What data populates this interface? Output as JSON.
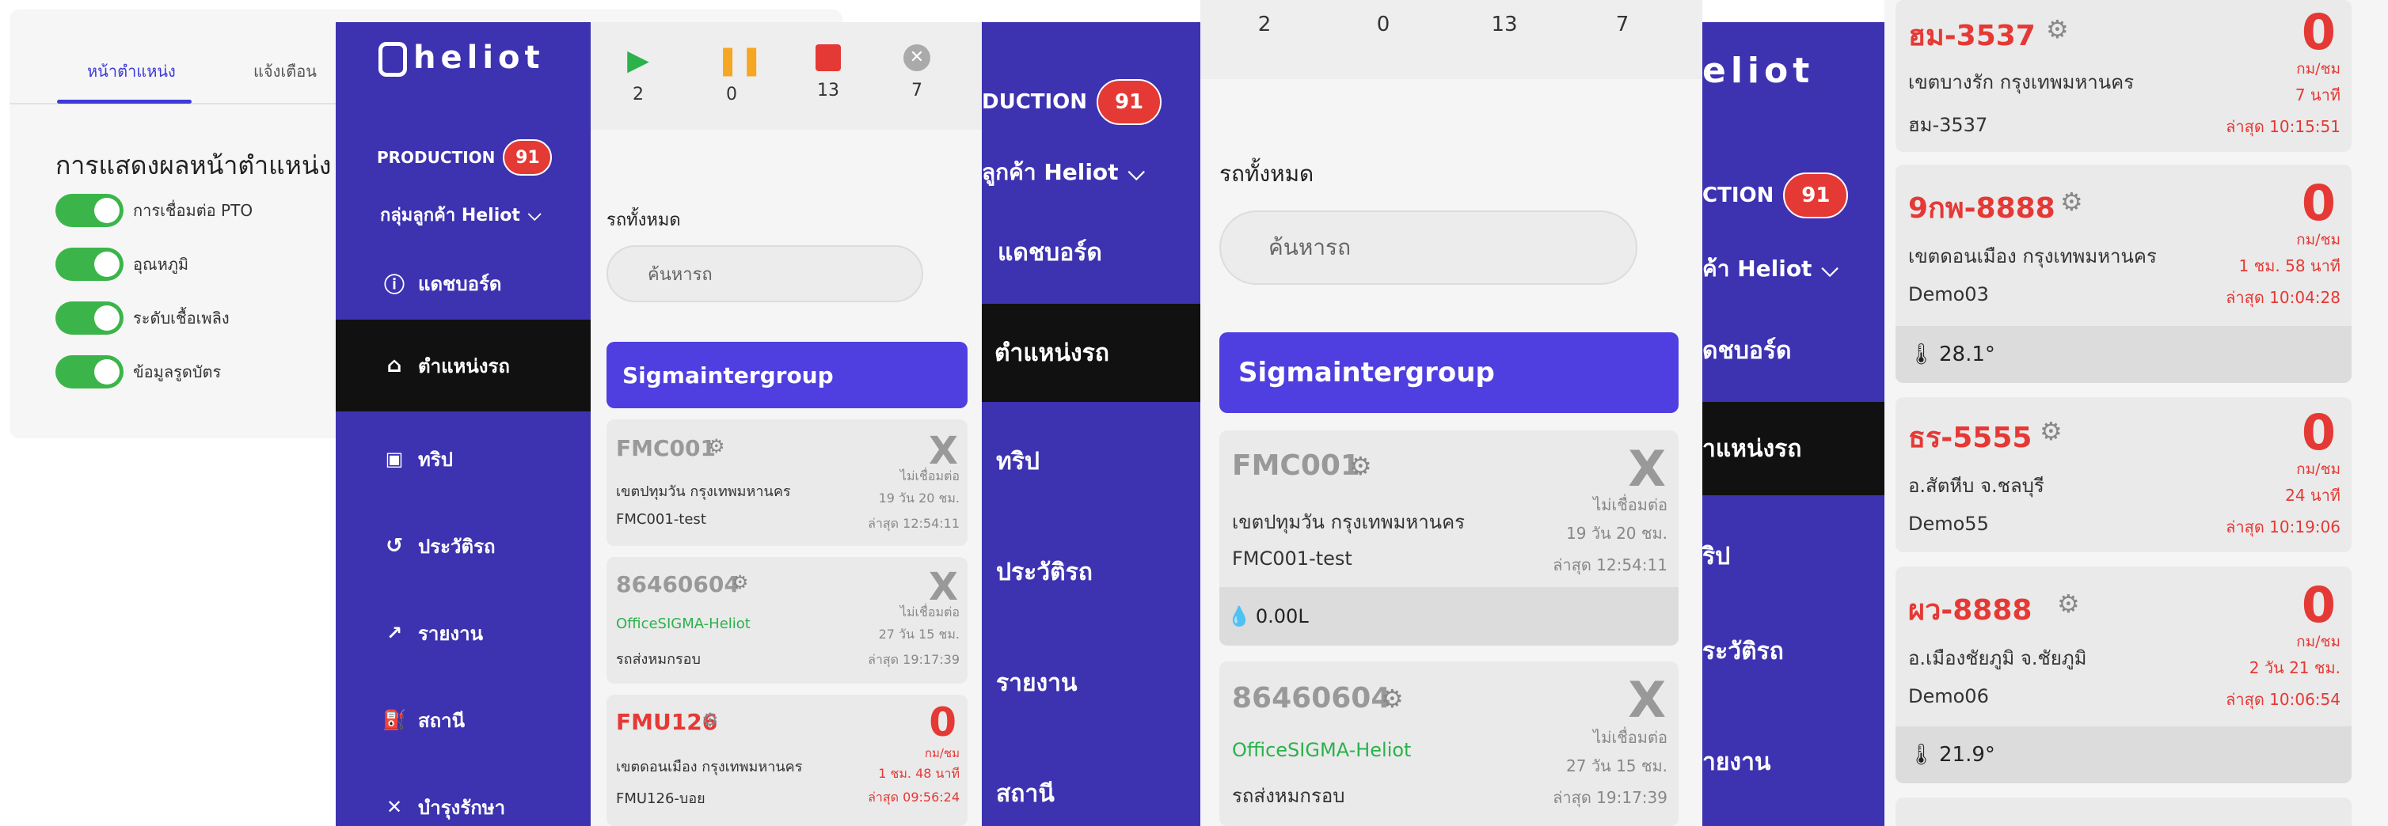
{
  "settings": {
    "tab_position": "หน้าตำแหน่ง",
    "tab_alert": "แจ้งเตือน",
    "title": "การแสดงผลหน้าตำแหน่ง",
    "toggles": [
      {
        "label": "การเชื่อมต่อ PTO",
        "on": true
      },
      {
        "label": "อุณหภูมิ",
        "on": true
      },
      {
        "label": "ระดับเชื้อเพลิง",
        "on": true
      },
      {
        "label": "ข้อมูลรูดบัตร",
        "on": true
      }
    ]
  },
  "app": {
    "logo": "heliot",
    "production_label": "PRODUCTION",
    "production_count": "91",
    "group_label": "กลุ่มลูกค้า Heliot",
    "menu": [
      {
        "label": "แดชบอร์ด",
        "icon": "info-icon"
      },
      {
        "label": "ตำแหน่งรถ",
        "icon": "location-icon"
      },
      {
        "label": "ทริป",
        "icon": "trip-icon"
      },
      {
        "label": "ประวัติรถ",
        "icon": "history-icon"
      },
      {
        "label": "รายงาน",
        "icon": "report-icon"
      },
      {
        "label": "สถานี",
        "icon": "station-icon"
      },
      {
        "label": "บำรุงรักษา",
        "icon": "maintenance-icon"
      }
    ],
    "menu_cropped_mid": [
      "แดชบอร์ด",
      "ตำแหน่งรถ",
      "ทริป",
      "ประวัติรถ",
      "รายงาน",
      "สถานี"
    ],
    "production_cropped": "DUCTION",
    "group_cropped_mid": "ลูกค้า Heliot",
    "logo_cropped": "eliot",
    "production_cropped_2": "CTION",
    "group_cropped_right": "ค้า Heliot",
    "menu_cropped_right": [
      "ดชบอร์ด",
      "าแหน่งรถ",
      "ริป",
      "ระวัติรถ",
      "ายงาน"
    ]
  },
  "stats": {
    "running": "2",
    "paused": "0",
    "stopped": "13",
    "offline": "7"
  },
  "list": {
    "all_label": "รถทั้งหมด",
    "search_placeholder": "ค้นหารถ",
    "group_name": "Sigmaintergroup",
    "offline_big": "X",
    "no_conn": "ไม่เชื่อมต่อ",
    "unit": "กม/ชม",
    "cards": [
      {
        "reg": "FMC001",
        "addr": "เขตปทุมวัน กรุงเทพมหานคร",
        "driver": "FMC001-test",
        "big": "X",
        "duration": "19 วัน 20 ชม.",
        "last": "ล่าสุด 12:54:11",
        "fuel": "0.00L"
      },
      {
        "reg": "86460604",
        "addr": "OfficeSIGMA-Heliot",
        "driver": "รถส่งหมกรอบ",
        "big": "X",
        "duration": "27 วัน 15 ชม.",
        "last": "ล่าสุด 19:17:39"
      },
      {
        "reg": "FMU126",
        "addr": "เขตดอนเมือง กรุงเทพมหานคร",
        "driver": "FMU126-บอย",
        "big": "0",
        "duration": "1 ชม. 48 นาที",
        "last": "ล่าสุด 09:56:24"
      }
    ]
  },
  "right_list": {
    "cards": [
      {
        "reg": "ฮม-3537",
        "addr": "เขตบางรัก กรุงเทพมหานคร",
        "driver": "ฮม-3537",
        "big": "0",
        "duration": "7 นาที",
        "last": "ล่าสุด 10:15:51"
      },
      {
        "reg": "9กพ-8888",
        "addr": "เขตดอนเมือง กรุงเทพมหานคร",
        "driver": "Demo03",
        "big": "0",
        "duration": "1 ชม. 58 นาที",
        "last": "ล่าสุด 10:04:28",
        "temp": "28.1°"
      },
      {
        "reg": "ธร-5555",
        "addr": "อ.สัตหีบ จ.ชลบุรี",
        "driver": "Demo55",
        "big": "0",
        "duration": "24 นาที",
        "last": "ล่าสุด 10:19:06"
      },
      {
        "reg": "ผว-8888",
        "addr": "อ.เมืองชัยภูมิ จ.ชัยภูมิ",
        "driver": "Demo06",
        "big": "0",
        "duration": "2 วัน 21 ชม.",
        "last": "ล่าสุด 10:06:54",
        "temp": "21.9°"
      }
    ]
  },
  "colors": {
    "sidebar": "#3d32b0",
    "accent": "#4f3ee0",
    "toggle_on": "#3bb54a",
    "badge": "#e53935",
    "active_menu": "#111111",
    "danger": "#e53935"
  }
}
